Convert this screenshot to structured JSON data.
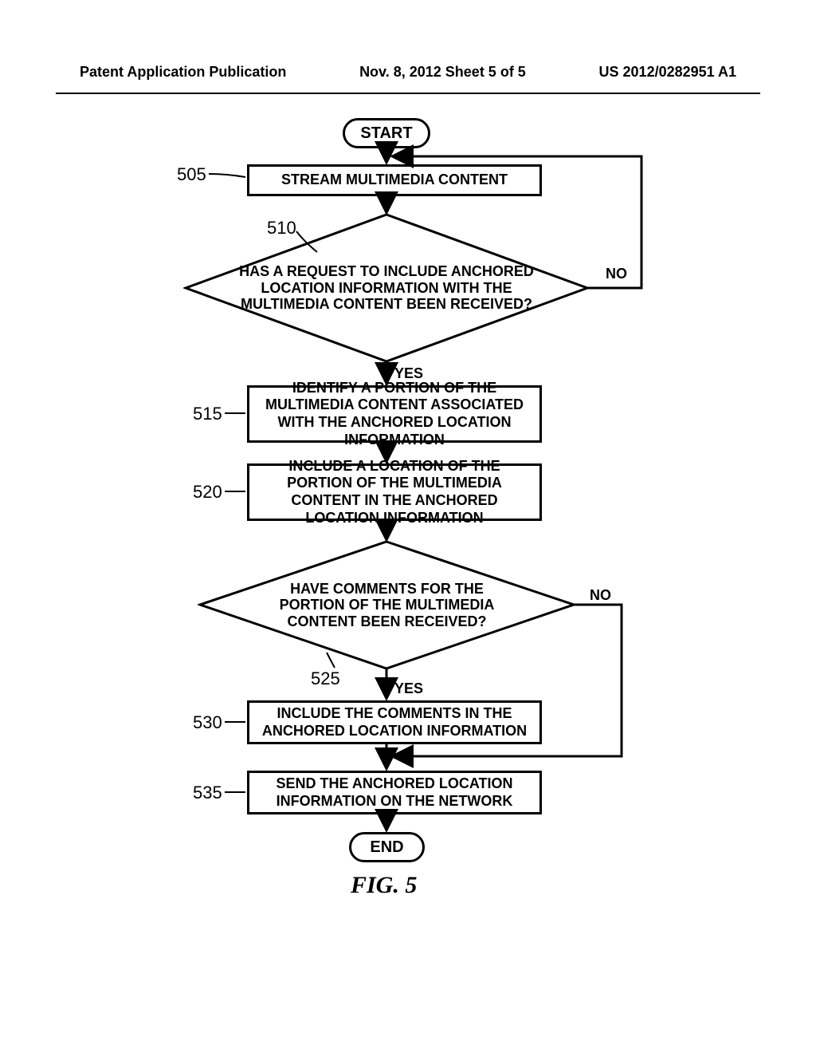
{
  "header": {
    "left": "Patent Application Publication",
    "center": "Nov. 8, 2012  Sheet 5 of 5",
    "right": "US 2012/0282951 A1"
  },
  "flowchart": {
    "start": "START",
    "end": "END",
    "figure_caption": "FIG. 5",
    "steps": {
      "s505": {
        "num": "505",
        "text": "STREAM MULTIMEDIA CONTENT"
      },
      "s510": {
        "num": "510",
        "text": "HAS A REQUEST TO INCLUDE ANCHORED LOCATION INFORMATION WITH THE MULTIMEDIA CONTENT BEEN RECEIVED?"
      },
      "s515": {
        "num": "515",
        "text": "IDENTIFY A PORTION OF THE MULTIMEDIA CONTENT ASSOCIATED WITH THE ANCHORED LOCATION INFORMATION"
      },
      "s520": {
        "num": "520",
        "text": "INCLUDE A LOCATION OF THE PORTION OF THE MULTIMEDIA CONTENT IN THE ANCHORED LOCATION INFORMATION"
      },
      "s525": {
        "num": "525",
        "text": "HAVE COMMENTS FOR THE PORTION OF THE MULTIMEDIA CONTENT BEEN RECEIVED?"
      },
      "s530": {
        "num": "530",
        "text": "INCLUDE THE COMMENTS IN THE ANCHORED LOCATION INFORMATION"
      },
      "s535": {
        "num": "535",
        "text": "SEND THE ANCHORED LOCATION INFORMATION ON THE NETWORK"
      }
    },
    "branches": {
      "yes": "YES",
      "no": "NO"
    }
  },
  "chart_data": {
    "type": "flowchart",
    "nodes": [
      {
        "id": "start",
        "type": "terminator",
        "text": "START"
      },
      {
        "id": "505",
        "type": "process",
        "text": "STREAM MULTIMEDIA CONTENT"
      },
      {
        "id": "510",
        "type": "decision",
        "text": "HAS A REQUEST TO INCLUDE ANCHORED LOCATION INFORMATION WITH THE MULTIMEDIA CONTENT BEEN RECEIVED?"
      },
      {
        "id": "515",
        "type": "process",
        "text": "IDENTIFY A PORTION OF THE MULTIMEDIA CONTENT ASSOCIATED WITH THE ANCHORED LOCATION INFORMATION"
      },
      {
        "id": "520",
        "type": "process",
        "text": "INCLUDE A LOCATION OF THE PORTION OF THE MULTIMEDIA CONTENT IN THE ANCHORED LOCATION INFORMATION"
      },
      {
        "id": "525",
        "type": "decision",
        "text": "HAVE COMMENTS FOR THE PORTION OF THE MULTIMEDIA CONTENT BEEN RECEIVED?"
      },
      {
        "id": "530",
        "type": "process",
        "text": "INCLUDE THE COMMENTS IN THE ANCHORED LOCATION INFORMATION"
      },
      {
        "id": "535",
        "type": "process",
        "text": "SEND THE ANCHORED LOCATION INFORMATION ON THE NETWORK"
      },
      {
        "id": "end",
        "type": "terminator",
        "text": "END"
      }
    ],
    "edges": [
      {
        "from": "start",
        "to": "505"
      },
      {
        "from": "505",
        "to": "510"
      },
      {
        "from": "510",
        "to": "515",
        "label": "YES"
      },
      {
        "from": "510",
        "to": "505",
        "label": "NO"
      },
      {
        "from": "515",
        "to": "520"
      },
      {
        "from": "520",
        "to": "525"
      },
      {
        "from": "525",
        "to": "530",
        "label": "YES"
      },
      {
        "from": "525",
        "to": "535",
        "label": "NO"
      },
      {
        "from": "530",
        "to": "535"
      },
      {
        "from": "535",
        "to": "end"
      }
    ],
    "title": "FIG. 5"
  }
}
